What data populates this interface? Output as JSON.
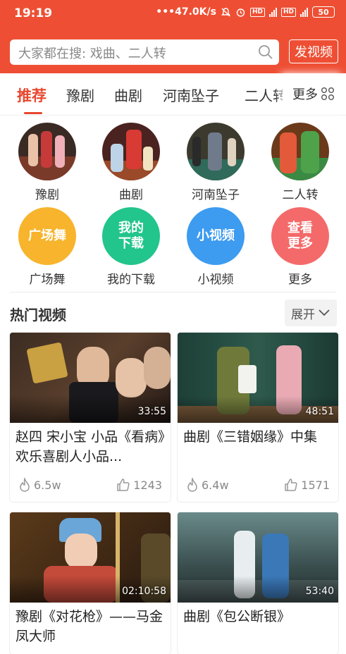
{
  "status_bar": {
    "time": "19:19",
    "speed": "47.0K/s",
    "battery": "50"
  },
  "search": {
    "placeholder": "大家都在搜: 戏曲、二人转",
    "post_video_label": "发视频"
  },
  "tabs": {
    "items": [
      {
        "label": "推荐",
        "active": true
      },
      {
        "label": "豫剧"
      },
      {
        "label": "曲剧"
      },
      {
        "label": "河南坠子"
      },
      {
        "label": "二人转"
      }
    ],
    "more_label": "更多"
  },
  "categories": [
    {
      "label": "豫剧"
    },
    {
      "label": "曲剧"
    },
    {
      "label": "河南坠子"
    },
    {
      "label": "二人转"
    },
    {
      "label": "广场舞",
      "icon_text": "广场舞",
      "color": "#f7b42c"
    },
    {
      "label": "我的下载",
      "icon_text_1": "我的",
      "icon_text_2": "下载",
      "color": "#22c58c"
    },
    {
      "label": "小视频",
      "icon_text": "小视频",
      "color": "#3d9bf0"
    },
    {
      "label": "更多",
      "icon_text_1": "查看",
      "icon_text_2": "更多",
      "color": "#f46a6a"
    }
  ],
  "hot": {
    "title": "热门视频",
    "expand_label": "展开"
  },
  "videos": [
    {
      "title": "赵四 宋小宝 小品《看病》欢乐喜剧人小品...",
      "duration": "33:55",
      "views": "6.5w",
      "likes": "1243"
    },
    {
      "title": "曲剧《三错姻缘》中集",
      "duration": "48:51",
      "views": "6.4w",
      "likes": "1571"
    },
    {
      "title": "豫剧《对花枪》——马金凤大师",
      "duration": "02:10:58"
    },
    {
      "title": "曲剧《包公断银》",
      "duration": "53:40"
    }
  ],
  "colors": {
    "brand": "#ee4f34",
    "tab_active": "#e8472f"
  }
}
